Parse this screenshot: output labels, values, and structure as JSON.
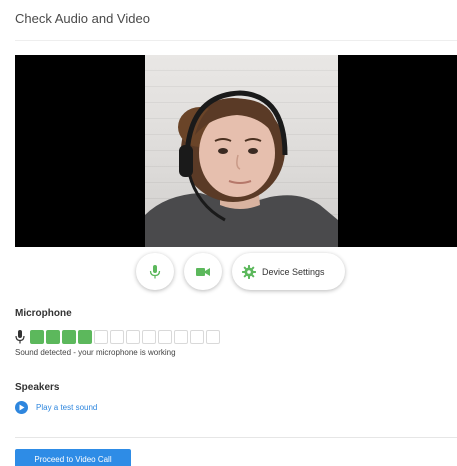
{
  "header": {
    "title": "Check Audio and Video"
  },
  "controls": {
    "mic_icon": "microphone-icon",
    "camera_icon": "video-camera-icon",
    "settings_icon": "gear-icon",
    "settings_label": "Device Settings"
  },
  "microphone": {
    "title": "Microphone",
    "level_active_cells": 4,
    "level_total_cells": 12,
    "status": "Sound detected - your microphone is working"
  },
  "speakers": {
    "title": "Speakers",
    "test_label": "Play a test sound"
  },
  "footer": {
    "proceed_label": "Proceed to Video Call"
  },
  "colors": {
    "accent_green": "#5cb85c",
    "accent_blue": "#2e86de",
    "button_blue": "#2e8ce6"
  }
}
